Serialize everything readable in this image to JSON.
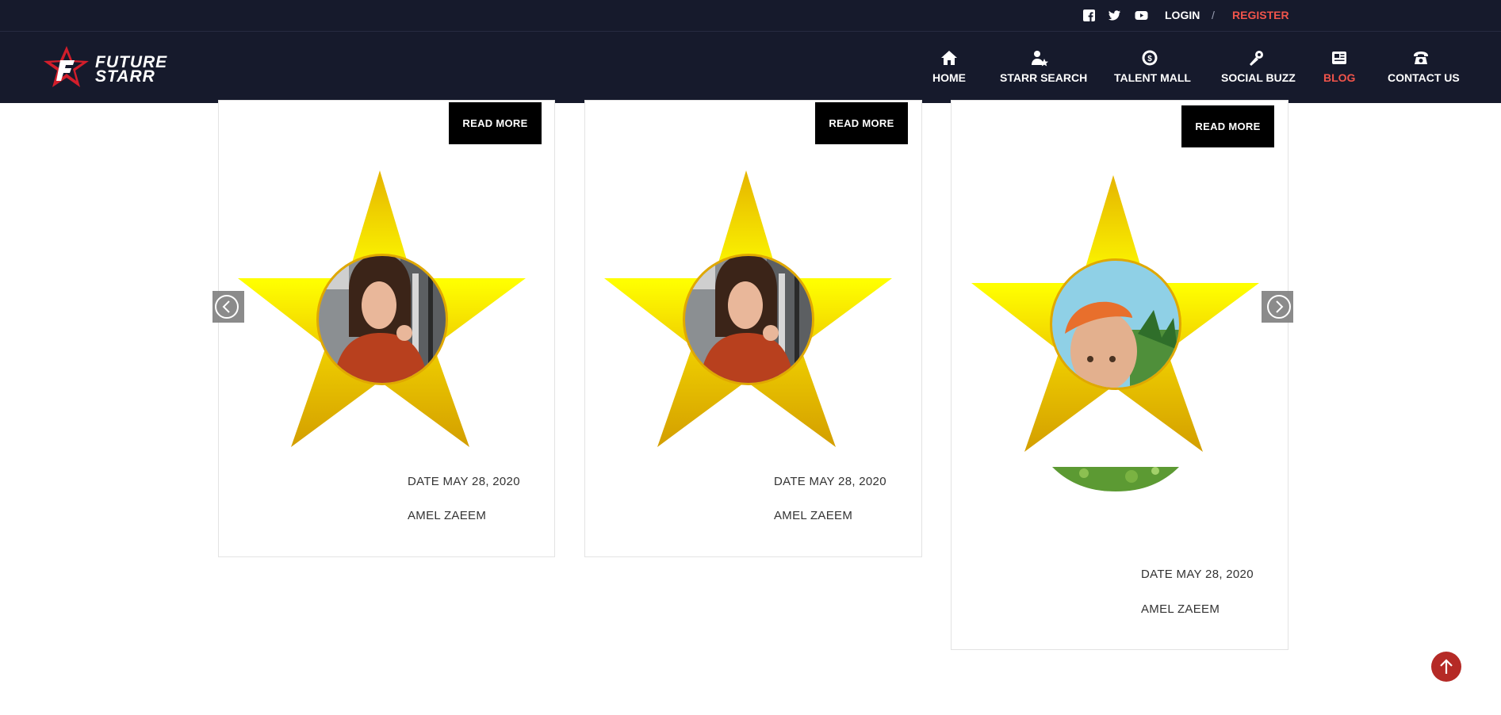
{
  "topbar": {
    "social": [
      {
        "icon": "facebook-icon"
      },
      {
        "icon": "twitter-icon"
      },
      {
        "icon": "youtube-icon"
      }
    ],
    "login": "LOGIN",
    "separator": "/",
    "register": "REGISTER"
  },
  "brand": {
    "line1": "FUTURE",
    "line2": "STARR"
  },
  "nav": [
    {
      "label": "HOME",
      "icon": "home-icon"
    },
    {
      "label": "STARR SEARCH",
      "icon": "user-star-icon"
    },
    {
      "label": "TALENT MALL",
      "icon": "dollar-badge-icon"
    },
    {
      "label": "SOCIAL BUZZ",
      "icon": "microphone-icon"
    },
    {
      "label": "BLOG",
      "icon": "newspaper-icon",
      "active": true
    },
    {
      "label": "CONTACT US",
      "icon": "telephone-icon"
    }
  ],
  "cards": [
    {
      "read_more": "READ MORE",
      "date": "DATE MAY 28, 2020",
      "author": "AMEL ZAEEM"
    },
    {
      "read_more": "READ MORE",
      "date": "DATE MAY 28, 2020",
      "author": "AMEL ZAEEM"
    },
    {
      "read_more": "READ MORE",
      "date": "DATE MAY 28, 2020",
      "author": "AMEL ZAEEM"
    }
  ],
  "colors": {
    "header_bg": "#161a2c",
    "accent": "#f0544b",
    "star_gold": "#e8b800",
    "scroll_top_bg": "#b52a26"
  }
}
